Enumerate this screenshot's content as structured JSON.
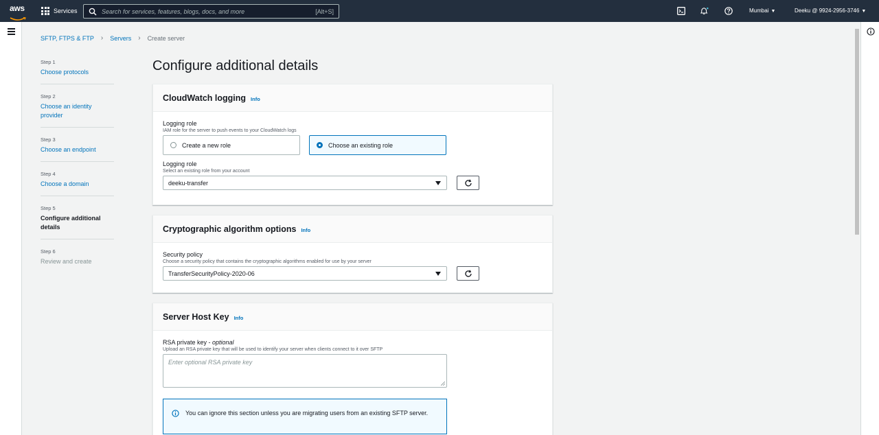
{
  "topnav": {
    "logo_text": "aws",
    "services_label": "Services",
    "search_placeholder": "Search for services, features, blogs, docs, and more",
    "search_shortcut": "[Alt+S]",
    "region": "Mumbai",
    "account": "Deeku @ 9924-2956-3746"
  },
  "breadcrumb": {
    "items": [
      "SFTP, FTPS & FTP",
      "Servers",
      "Create server"
    ]
  },
  "steps": [
    {
      "label": "Step 1",
      "name": "Choose protocols"
    },
    {
      "label": "Step 2",
      "name": "Choose an identity provider"
    },
    {
      "label": "Step 3",
      "name": "Choose an endpoint"
    },
    {
      "label": "Step 4",
      "name": "Choose a domain"
    },
    {
      "label": "Step 5",
      "name": "Configure additional details"
    },
    {
      "label": "Step 6",
      "name": "Review and create"
    }
  ],
  "page_title": "Configure additional details",
  "cloudwatch": {
    "title": "CloudWatch logging",
    "info": "Info",
    "logging_role_label": "Logging role",
    "logging_role_desc": "IAM role for the server to push events to your CloudWatch logs",
    "option_new": "Create a new role",
    "option_existing": "Choose an existing role",
    "selected_option": "existing",
    "select_label": "Logging role",
    "select_desc": "Select an existing role from your account",
    "select_value": "deeku-transfer"
  },
  "crypto": {
    "title": "Cryptographic algorithm options",
    "info": "Info",
    "policy_label": "Security policy",
    "policy_desc": "Choose a security policy that contains the cryptographic algorithms enabled for use by your server",
    "policy_value": "TransferSecurityPolicy-2020-06"
  },
  "hostkey": {
    "title": "Server Host Key",
    "info": "Info",
    "rsa_label": "RSA private key - ",
    "rsa_optional": "optional",
    "rsa_desc": "Upload an RSA private key that will be used to identify your server when clients connect to it over SFTP",
    "rsa_placeholder": "Enter optional RSA private key",
    "alert_text": "You can ignore this section unless you are migrating users from an existing SFTP server."
  },
  "colors": {
    "nav_bg": "#232f3e",
    "link": "#0073bb",
    "page_bg": "#f2f3f3"
  }
}
